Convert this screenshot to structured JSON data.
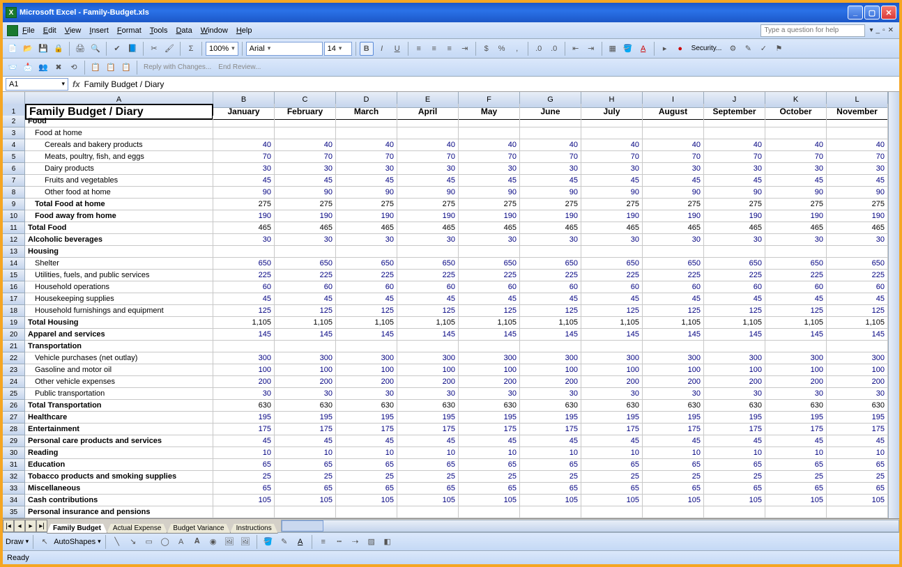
{
  "title": "Microsoft Excel - Family-Budget.xls",
  "menus": [
    "File",
    "Edit",
    "View",
    "Insert",
    "Format",
    "Tools",
    "Data",
    "Window",
    "Help"
  ],
  "help_placeholder": "Type a question for help",
  "zoom": "100%",
  "font": "Arial",
  "font_size": "14",
  "review": {
    "reply": "Reply with Changes...",
    "end": "End Review..."
  },
  "namebox": "A1",
  "formula": "Family Budget / Diary",
  "security": "Security...",
  "draw": "Draw",
  "autoshapes": "AutoShapes",
  "status": "Ready",
  "col_headers": [
    "A",
    "B",
    "C",
    "D",
    "E",
    "F",
    "G",
    "H",
    "I",
    "J",
    "K",
    "L"
  ],
  "months": [
    "January",
    "February",
    "March",
    "April",
    "May",
    "June",
    "July",
    "August",
    "September",
    "October",
    "November"
  ],
  "sheet_title": "Family Budget / Diary",
  "rows": [
    {
      "n": 2,
      "label": "Food",
      "cls": "bold"
    },
    {
      "n": 3,
      "label": "Food at home",
      "cls": "ind1"
    },
    {
      "n": 4,
      "label": "Cereals and bakery products",
      "cls": "ind2",
      "v": 40
    },
    {
      "n": 5,
      "label": "Meats, poultry, fish, and eggs",
      "cls": "ind2",
      "v": 70
    },
    {
      "n": 6,
      "label": "Dairy products",
      "cls": "ind2",
      "v": 30
    },
    {
      "n": 7,
      "label": "Fruits and vegetables",
      "cls": "ind2",
      "v": 45
    },
    {
      "n": 8,
      "label": "Other food at home",
      "cls": "ind2",
      "v": 90
    },
    {
      "n": 9,
      "label": "Total Food at home",
      "cls": "ind1 bold",
      "t": 275
    },
    {
      "n": 10,
      "label": "Food away from home",
      "cls": "ind1 bold",
      "v": 190
    },
    {
      "n": 11,
      "label": "Total Food",
      "cls": "bold",
      "t": 465
    },
    {
      "n": 12,
      "label": "Alcoholic beverages",
      "cls": "bold",
      "v": 30
    },
    {
      "n": 13,
      "label": "Housing",
      "cls": "bold"
    },
    {
      "n": 14,
      "label": "Shelter",
      "cls": "ind1",
      "v": 650
    },
    {
      "n": 15,
      "label": "Utilities, fuels, and public services",
      "cls": "ind1",
      "v": 225
    },
    {
      "n": 16,
      "label": "Household operations",
      "cls": "ind1",
      "v": 60
    },
    {
      "n": 17,
      "label": "Housekeeping supplies",
      "cls": "ind1",
      "v": 45
    },
    {
      "n": 18,
      "label": "Household furnishings and equipment",
      "cls": "ind1",
      "v": 125
    },
    {
      "n": 19,
      "label": "Total Housing",
      "cls": "bold",
      "t": "1,105"
    },
    {
      "n": 20,
      "label": "Apparel and services",
      "cls": "bold",
      "v": 145
    },
    {
      "n": 21,
      "label": "Transportation",
      "cls": "bold"
    },
    {
      "n": 22,
      "label": "Vehicle purchases (net outlay)",
      "cls": "ind1",
      "v": 300
    },
    {
      "n": 23,
      "label": "Gasoline and motor oil",
      "cls": "ind1",
      "v": 100
    },
    {
      "n": 24,
      "label": "Other vehicle expenses",
      "cls": "ind1",
      "v": 200
    },
    {
      "n": 25,
      "label": "Public transportation",
      "cls": "ind1",
      "v": 30
    },
    {
      "n": 26,
      "label": "Total Transportation",
      "cls": "bold",
      "t": 630
    },
    {
      "n": 27,
      "label": "Healthcare",
      "cls": "bold",
      "v": 195
    },
    {
      "n": 28,
      "label": "Entertainment",
      "cls": "bold",
      "v": 175
    },
    {
      "n": 29,
      "label": "Personal care products and services",
      "cls": "bold",
      "v": 45
    },
    {
      "n": 30,
      "label": "Reading",
      "cls": "bold",
      "v": 10
    },
    {
      "n": 31,
      "label": "Education",
      "cls": "bold",
      "v": 65
    },
    {
      "n": 32,
      "label": "Tobacco products and smoking supplies",
      "cls": "bold",
      "v": 25
    },
    {
      "n": 33,
      "label": "Miscellaneous",
      "cls": "bold",
      "v": 65
    },
    {
      "n": 34,
      "label": "Cash contributions",
      "cls": "bold",
      "v": 105
    },
    {
      "n": 35,
      "label": "Personal insurance and pensions",
      "cls": "bold"
    }
  ],
  "tabs": [
    "Family Budget",
    "Actual Expense",
    "Budget Variance",
    "Instructions"
  ],
  "active_tab": 0
}
